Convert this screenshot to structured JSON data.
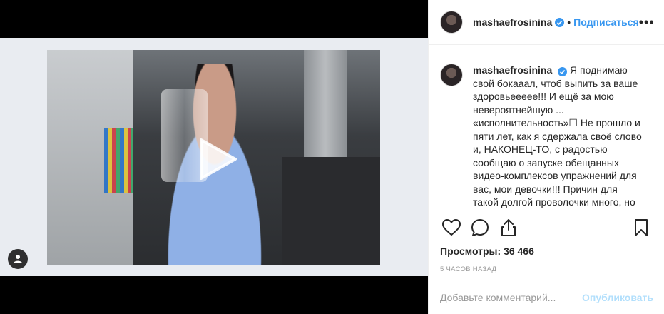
{
  "post": {
    "username": "mashaefrosinina",
    "verified": true,
    "separator": "•",
    "follow_label": "Подписаться",
    "more_label": "•••"
  },
  "caption": {
    "username": "mashaefrosinina",
    "text": "Я поднимаю свой бокааал, чтоб выпить за ваше здоровьеееее!!! И ещё за мою невероятнейшую ... «исполнительность»☐ Не прошло и пяти лет, как я сдержала своё слово и, НАКОНЕЦ-ТО, с радостью сообщаю о запуске обещанных видео-комплексов упражнений для вас, мои девочки!!! Причин для такой долгой проволочки много, но"
  },
  "stats": {
    "views_label": "Просмотры:",
    "views_count": "36 466",
    "timestamp": "5 часов назад"
  },
  "comment": {
    "placeholder": "Добавьте комментарий...",
    "publish_label": "Опубликовать"
  },
  "icons": {
    "like": "heart-icon",
    "comment": "comment-icon",
    "share": "share-icon",
    "save": "bookmark-icon",
    "play": "play-icon",
    "user_tag": "user-icon",
    "verified": "verified-badge-icon"
  },
  "colors": {
    "accent": "#3897f0",
    "publish_disabled": "#b2dffc",
    "muted": "#999999"
  }
}
